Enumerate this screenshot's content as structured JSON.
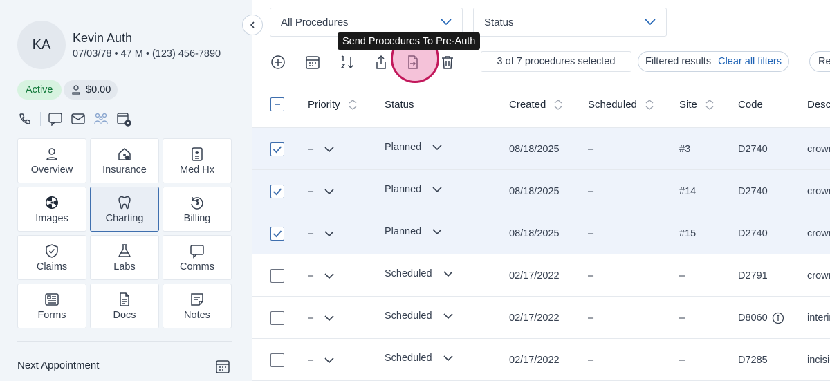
{
  "patient": {
    "initials": "KA",
    "name": "Kevin Auth",
    "info": "07/03/78 • 47 M • (123) 456-7890",
    "status": "Active",
    "balance": "$0.00"
  },
  "nav": [
    {
      "label": "Overview",
      "icon": "user-icon"
    },
    {
      "label": "Insurance",
      "icon": "insurance-icon"
    },
    {
      "label": "Med Hx",
      "icon": "medical-history-icon"
    },
    {
      "label": "Images",
      "icon": "radiation-icon"
    },
    {
      "label": "Charting",
      "icon": "tooth-icon"
    },
    {
      "label": "Billing",
      "icon": "billing-icon"
    },
    {
      "label": "Claims",
      "icon": "shield-check-icon"
    },
    {
      "label": "Labs",
      "icon": "flask-icon"
    },
    {
      "label": "Comms",
      "icon": "chat-icon"
    },
    {
      "label": "Forms",
      "icon": "form-icon"
    },
    {
      "label": "Docs",
      "icon": "document-icon"
    },
    {
      "label": "Notes",
      "icon": "note-icon"
    }
  ],
  "next_appointment": "Next Appointment",
  "filters": {
    "procedures": "All Procedures",
    "status": "Status"
  },
  "toolbar": {
    "tooltip": "Send Procedures To Pre-Auth",
    "selection": "3 of 7 procedures selected",
    "filtered": "Filtered results",
    "clear": "Clear all filters",
    "refresh": "Refresh"
  },
  "table": {
    "headers": {
      "priority": "Priority",
      "status": "Status",
      "created": "Created",
      "scheduled": "Scheduled",
      "site": "Site",
      "code": "Code",
      "description": "Description"
    },
    "rows": [
      {
        "checked": true,
        "priority": "–",
        "status": "Planned",
        "created": "08/18/2025",
        "scheduled": "–",
        "site": "#3",
        "code": "D2740",
        "description": "crown"
      },
      {
        "checked": true,
        "priority": "–",
        "status": "Planned",
        "created": "08/18/2025",
        "scheduled": "–",
        "site": "#14",
        "code": "D2740",
        "description": "crown"
      },
      {
        "checked": true,
        "priority": "–",
        "status": "Planned",
        "created": "08/18/2025",
        "scheduled": "–",
        "site": "#15",
        "code": "D2740",
        "description": "crown"
      },
      {
        "checked": false,
        "priority": "–",
        "status": "Scheduled",
        "created": "02/17/2022",
        "scheduled": "–",
        "site": "–",
        "code": "D2791",
        "description": "crown"
      },
      {
        "checked": false,
        "priority": "–",
        "status": "Scheduled",
        "created": "02/17/2022",
        "scheduled": "–",
        "site": "–",
        "code": "D8060",
        "description": "interim",
        "info": true
      },
      {
        "checked": false,
        "priority": "–",
        "status": "Scheduled",
        "created": "02/17/2022",
        "scheduled": "–",
        "site": "–",
        "code": "D7285",
        "description": "incisional"
      }
    ]
  },
  "colors": {
    "accent": "#3f6fae",
    "link": "#1f63b5",
    "active_badge_bg": "#d7f3e0",
    "active_badge_text": "#137a3b",
    "highlight": "#c2185b",
    "selected_row": "#eef3fb"
  }
}
